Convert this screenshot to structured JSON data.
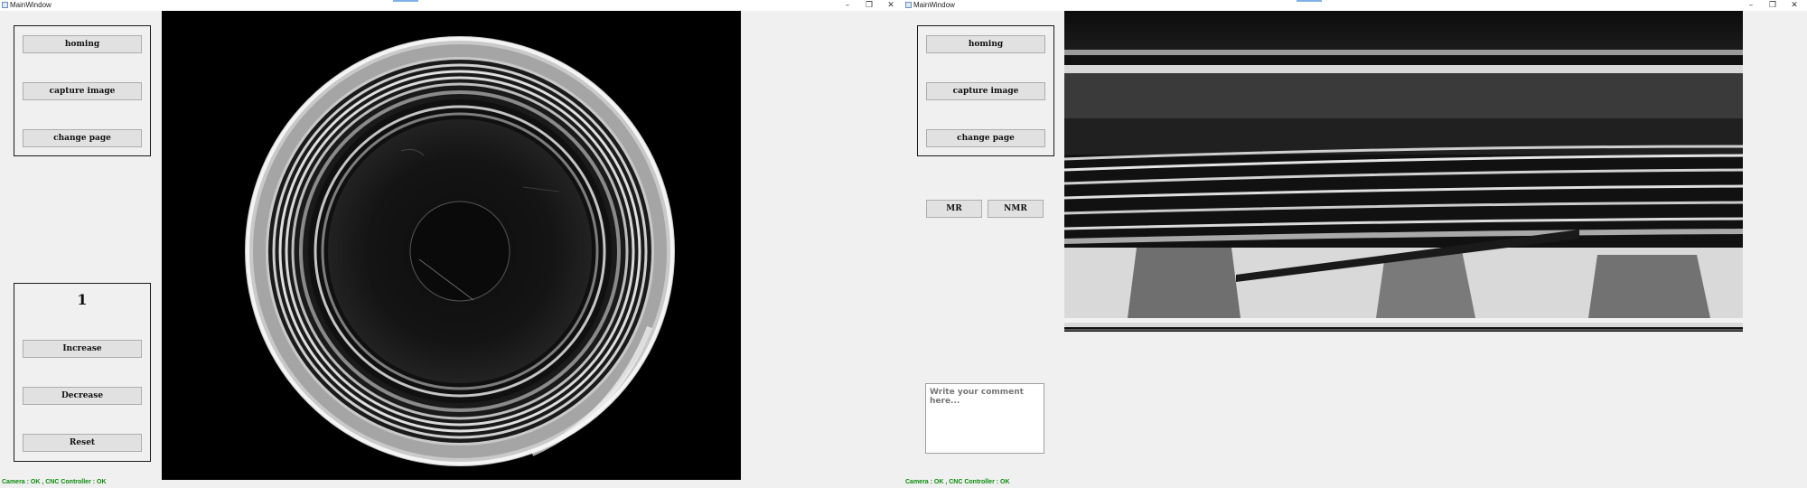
{
  "left_window": {
    "title": "MainWindow",
    "controls": {
      "minimize": "–",
      "restore": "❐",
      "close": "✕"
    },
    "buttons": {
      "homing": "homing",
      "capture": "capture image",
      "change_page": "change page"
    },
    "counter": {
      "value": "1",
      "increase": "Increase",
      "decrease": "Decrease",
      "reset": "Reset"
    },
    "status": "Camera : OK , CNC Controller : OK"
  },
  "right_window": {
    "title": "MainWindow",
    "controls": {
      "minimize": "–",
      "restore": "❐",
      "close": "✕"
    },
    "buttons": {
      "homing": "homing",
      "capture": "capture image",
      "change_page": "change page",
      "mr": "MR",
      "nmr": "NMR"
    },
    "comment": {
      "placeholder": "Write your comment here...",
      "value": ""
    },
    "status": "Camera : OK , CNC Controller : OK"
  },
  "colors": {
    "window_bg": "#f0f0f0",
    "button_bg": "#e1e1e1",
    "status_green": "#0a8a0a",
    "image_bg": "#000000"
  }
}
